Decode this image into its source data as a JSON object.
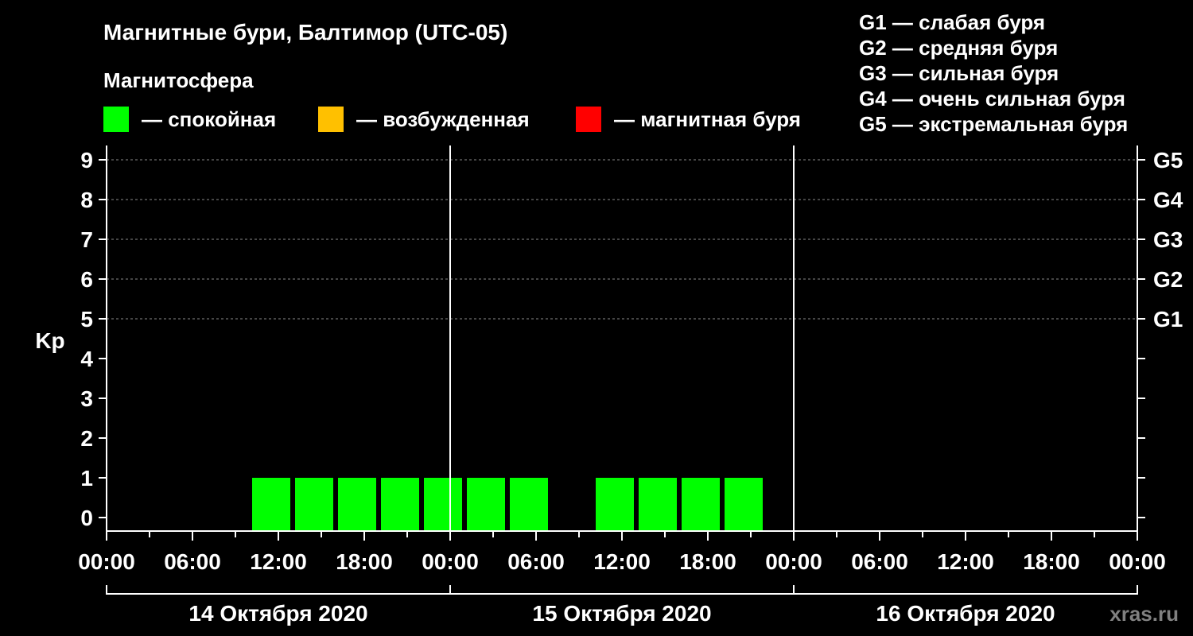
{
  "chart_data": {
    "type": "bar",
    "title": "Магнитные бури, Балтимор (UTC-05)",
    "legend_title": "Магнитосфера",
    "legend": [
      {
        "label": "— спокойная",
        "color": "#00ff00"
      },
      {
        "label": "— возбужденная",
        "color": "#ffc000"
      },
      {
        "label": "— магнитная буря",
        "color": "#ff0000"
      }
    ],
    "g_scale": [
      "G1 — слабая буря",
      "G2 — средняя буря",
      "G3 — сильная буря",
      "G4 — очень сильная буря",
      "G5 — экстремальная буря"
    ],
    "ylabel": "Kp",
    "ylim": [
      0,
      9
    ],
    "yticks": [
      0,
      1,
      2,
      3,
      4,
      5,
      6,
      7,
      8,
      9
    ],
    "y2ticks": [
      {
        "label": "G1",
        "kp": 5
      },
      {
        "label": "G2",
        "kp": 6
      },
      {
        "label": "G3",
        "kp": 7
      },
      {
        "label": "G4",
        "kp": 8
      },
      {
        "label": "G5",
        "kp": 9
      }
    ],
    "grid": true,
    "xlim": [
      "2020-10-14 00:00",
      "2020-10-17 00:00"
    ],
    "xtick_labels": [
      "00:00",
      "06:00",
      "12:00",
      "18:00",
      "00:00",
      "06:00",
      "12:00",
      "18:00",
      "00:00",
      "06:00",
      "12:00",
      "18:00",
      "00:00"
    ],
    "date_labels": [
      "14 Октября 2020",
      "15 Октября 2020",
      "16 Октября 2020"
    ],
    "bars": [
      {
        "start": "2020-10-14 10:00",
        "end": "2020-10-14 13:00",
        "kp": 1,
        "color": "#00ff00"
      },
      {
        "start": "2020-10-14 13:00",
        "end": "2020-10-14 16:00",
        "kp": 1,
        "color": "#00ff00"
      },
      {
        "start": "2020-10-14 16:00",
        "end": "2020-10-14 19:00",
        "kp": 1,
        "color": "#00ff00"
      },
      {
        "start": "2020-10-14 19:00",
        "end": "2020-10-14 22:00",
        "kp": 1,
        "color": "#00ff00"
      },
      {
        "start": "2020-10-14 22:00",
        "end": "2020-10-15 01:00",
        "kp": 1,
        "color": "#00ff00"
      },
      {
        "start": "2020-10-15 01:00",
        "end": "2020-10-15 04:00",
        "kp": 1,
        "color": "#00ff00"
      },
      {
        "start": "2020-10-15 04:00",
        "end": "2020-10-15 07:00",
        "kp": 1,
        "color": "#00ff00"
      },
      {
        "start": "2020-10-15 10:00",
        "end": "2020-10-15 13:00",
        "kp": 1,
        "color": "#00ff00"
      },
      {
        "start": "2020-10-15 13:00",
        "end": "2020-10-15 16:00",
        "kp": 1,
        "color": "#00ff00"
      },
      {
        "start": "2020-10-15 16:00",
        "end": "2020-10-15 19:00",
        "kp": 1,
        "color": "#00ff00"
      },
      {
        "start": "2020-10-15 19:00",
        "end": "2020-10-15 22:00",
        "kp": 1,
        "color": "#00ff00"
      }
    ]
  },
  "watermark": "xras.ru"
}
